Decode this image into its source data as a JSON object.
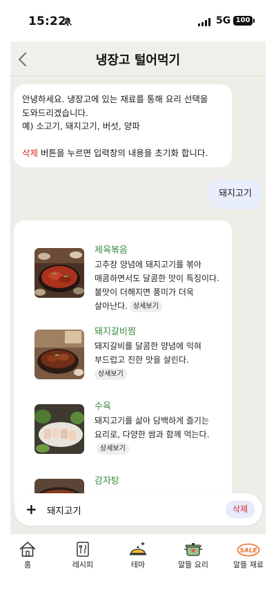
{
  "status_bar": {
    "time": "15:22",
    "network": "5G",
    "battery": "100"
  },
  "header": {
    "title": "냉장고 털어먹기"
  },
  "bot_message": {
    "line1": "안녕하세요. 냉장고에 있는 재료를 통해 요리 선택을",
    "line2": "도와드리겠습니다.",
    "line3": "예) 소고기, 돼지고기, 버섯, 양파",
    "delete_word": "삭제",
    "line4_rest": " 버튼을 누르면 입력창의 내용을 초기화 합니다."
  },
  "user_message": "돼지고기",
  "recipes": [
    {
      "name": "제육볶음",
      "description": "고추장 양념에 돼지고기를 볶아 매콤하면서도 달콤한 맛이 특징이다. 불맛이 더해지면 풍미가 더욱 살아난다.",
      "detail_label": "상세보기"
    },
    {
      "name": "돼지갈비찜",
      "description": "돼지갈비를 달콤한 양념에 익혀 부드럽고 진한 맛을 살린다.",
      "detail_label": "상세보기"
    },
    {
      "name": "수육",
      "description": "돼지고기를 삶아 담백하게 즐기는 요리로, 다양한 쌈과 함께 먹는다.",
      "detail_label": "상세보기"
    },
    {
      "name": "감자탕",
      "description": "",
      "detail_label": ""
    }
  ],
  "input_bar": {
    "plus": "+",
    "value": "돼지고기",
    "delete_label": "삭제"
  },
  "bottom_nav": [
    {
      "label": "홈",
      "icon": "home-icon"
    },
    {
      "label": "레시피",
      "icon": "recipe-icon"
    },
    {
      "label": "테마",
      "icon": "cloche-icon"
    },
    {
      "label": "알뜰 요리",
      "icon": "pot-icon"
    },
    {
      "label": "알뜰 재료",
      "icon": "sale-icon"
    }
  ],
  "colors": {
    "accent_green": "#3a8a3e",
    "delete_red": "#d62a2a",
    "user_bubble": "#e9eefb",
    "background": "#efede8"
  }
}
